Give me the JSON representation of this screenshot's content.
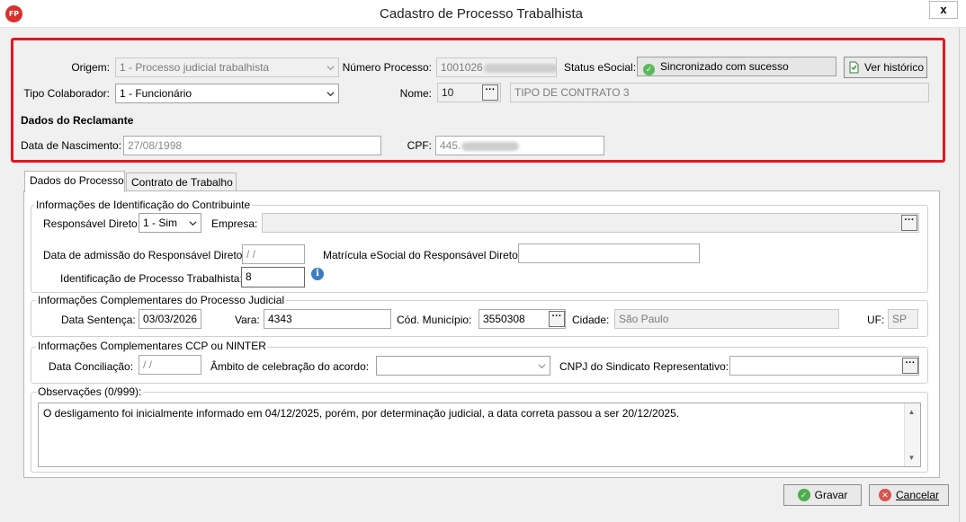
{
  "window": {
    "title": "Cadastro de Processo Trabalhista",
    "icon_text": "FP",
    "close_label": "x"
  },
  "header": {
    "origem_label": "Origem:",
    "origem_value": "1 - Processo judicial trabalhista",
    "numero_label": "Número Processo:",
    "numero_value_prefix": "1001026",
    "status_label": "Status eSocial:",
    "status_value": "Sincronizado com sucesso",
    "historico_button": "Ver histórico",
    "tipo_label": "Tipo Colaborador:",
    "tipo_value": "1 - Funcionário",
    "nome_label": "Nome:",
    "nome_code": "10",
    "nome_value": "TIPO DE CONTRATO 3",
    "reclamante_heading": "Dados do Reclamante",
    "nascimento_label": "Data de Nascimento:",
    "nascimento_value": "27/08/1998",
    "cpf_label": "CPF:",
    "cpf_value_prefix": "445."
  },
  "tabs": [
    {
      "label": "Dados do Processo",
      "active": true
    },
    {
      "label": "Contrato de Trabalho",
      "active": false
    }
  ],
  "identificacao": {
    "title": "Informações de Identificação do Contribuinte",
    "responsavel_label": "Responsável Direto:",
    "responsavel_value": "1 - Sim",
    "empresa_label": "Empresa:",
    "empresa_value": "",
    "admissao_label": "Data de admissão do Responsável Direto:",
    "admissao_value": " / /",
    "matricula_label": "Matrícula eSocial do Responsável Direto",
    "matricula_value": "",
    "ident_processo_label": "Identificação de Processo Trabalhista:",
    "ident_processo_value": "8"
  },
  "complementares": {
    "title": "Informações Complementares do Processo Judicial",
    "data_sentenca_label": "Data Sentença:",
    "data_sentenca_value": "03/03/2026",
    "vara_label": "Vara:",
    "vara_value": "4343",
    "municipio_label": "Cód. Município:",
    "municipio_value": "3550308",
    "cidade_label": "Cidade:",
    "cidade_value": "São Paulo",
    "uf_label": "UF:",
    "uf_value": "SP"
  },
  "ccp": {
    "title": "Informações Complementares CCP ou NINTER",
    "conciliacao_label": "Data Conciliação:",
    "conciliacao_value": " / /",
    "ambito_label": "Âmbito de celebração do acordo:",
    "ambito_value": "",
    "cnpj_label": "CNPJ do Sindicato Representativo:",
    "cnpj_value": ""
  },
  "observacoes": {
    "title": "Observações (0/999):",
    "text": "O desligamento foi inicialmente informado em 04/12/2025, porém, por determinação judicial, a data correta passou a ser 20/12/2025."
  },
  "footer": {
    "save_label": "Gravar",
    "cancel_label": "Cancelar"
  },
  "colors": {
    "highlight_border": "#e8141f",
    "status_ok": "#5cb85c",
    "info_blue": "#3b7dc4"
  },
  "icons": [
    "app-logo-icon",
    "check-circle-icon",
    "history-document-icon",
    "ellipsis-icon",
    "chevron-down-icon",
    "info-icon",
    "save-check-icon",
    "cancel-x-icon"
  ]
}
